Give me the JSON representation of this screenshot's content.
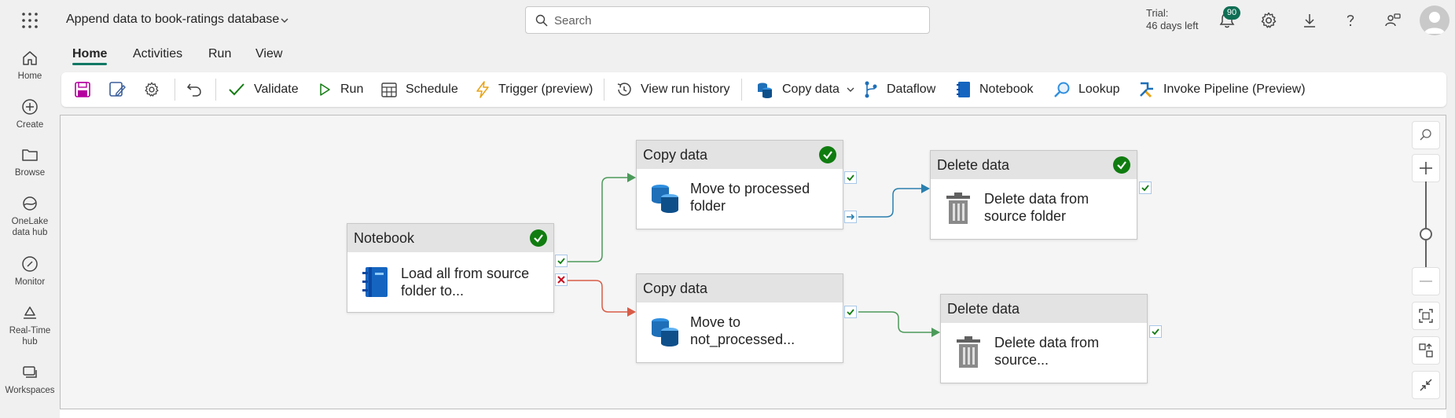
{
  "app": {
    "title": "Append data to book-ratings database"
  },
  "search": {
    "placeholder": "Search"
  },
  "trial": {
    "line1": "Trial:",
    "line2": "46 days left"
  },
  "notifications": {
    "count": "90"
  },
  "leftnav": {
    "items": [
      {
        "label": "Home",
        "icon": "home-icon"
      },
      {
        "label": "Create",
        "icon": "create-icon"
      },
      {
        "label": "Browse",
        "icon": "browse-icon"
      },
      {
        "label": "OneLake data hub",
        "icon": "onelake-icon"
      },
      {
        "label": "Monitor",
        "icon": "monitor-icon"
      },
      {
        "label": "Real-Time hub",
        "icon": "realtime-icon"
      },
      {
        "label": "Workspaces",
        "icon": "workspaces-icon"
      }
    ]
  },
  "tabs": [
    "Home",
    "Activities",
    "Run",
    "View"
  ],
  "ribbon": {
    "validate": "Validate",
    "run": "Run",
    "schedule": "Schedule",
    "trigger": "Trigger (preview)",
    "run_history": "View run history",
    "copy_data": "Copy data",
    "dataflow": "Dataflow",
    "notebook": "Notebook",
    "lookup": "Lookup",
    "invoke_pipeline": "Invoke Pipeline (Preview)"
  },
  "activities": {
    "notebook": {
      "type": "Notebook",
      "label": "Load all from source folder to..."
    },
    "copy_processed": {
      "type": "Copy data",
      "label": "Move to processed folder"
    },
    "copy_not_processed": {
      "type": "Copy data",
      "label": "Move to  not_processed..."
    },
    "delete_top": {
      "type": "Delete data",
      "label": "Delete data from source folder"
    },
    "delete_bottom": {
      "type": "Delete data",
      "label": "Delete data from source..."
    }
  },
  "colors": {
    "accent": "#117865",
    "success": "#107c10",
    "fail": "#c50f1f",
    "success_path": "#4c9a5a",
    "fail_path": "#d85c47",
    "completion_path": "#2a7fae"
  }
}
